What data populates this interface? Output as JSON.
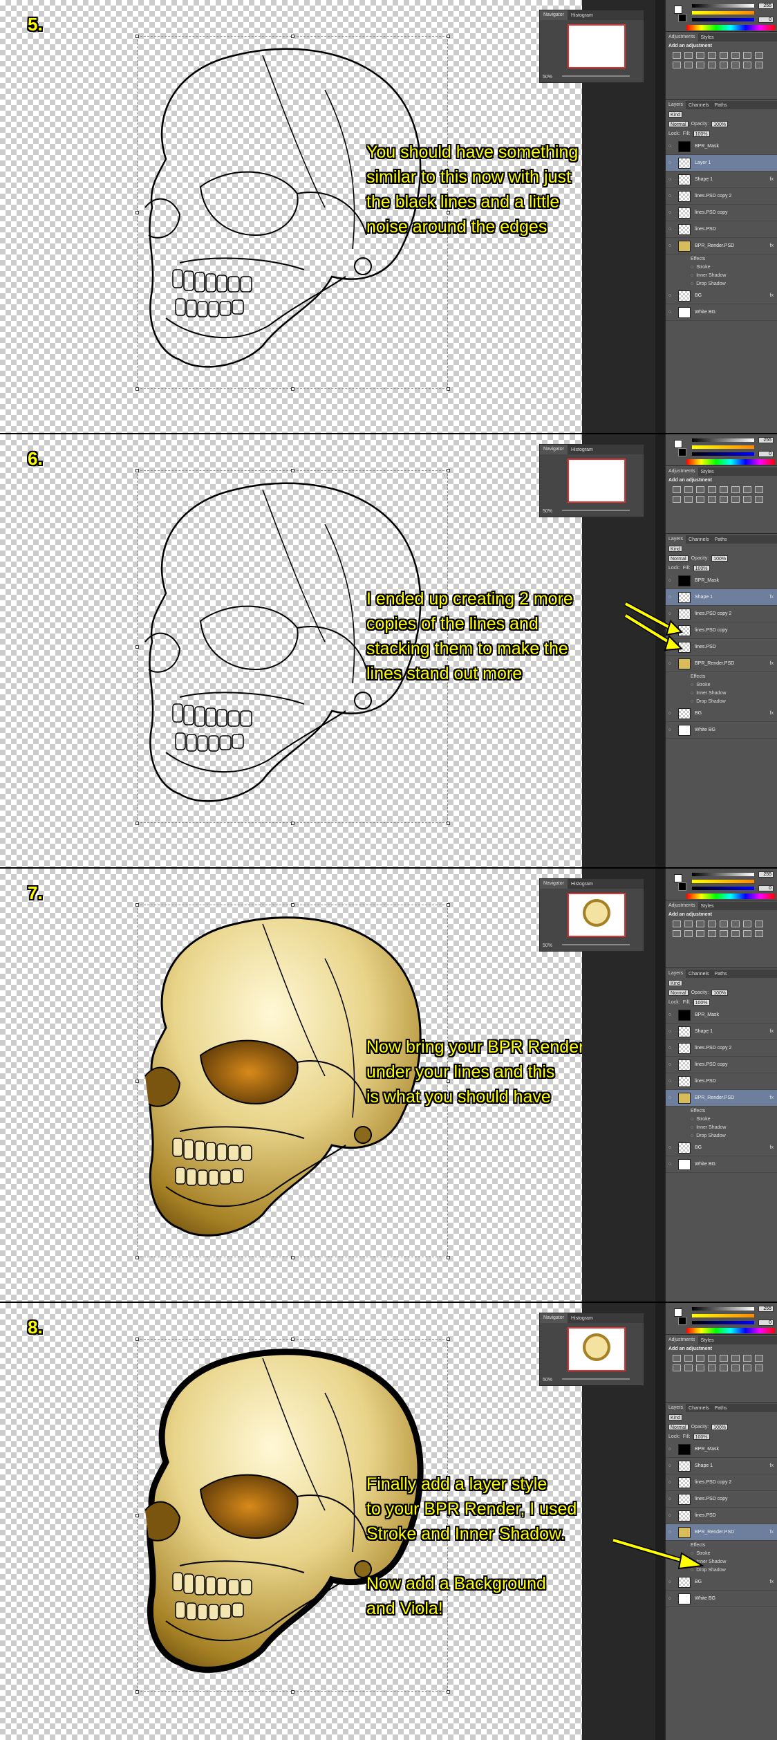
{
  "steps": [
    {
      "number": "5.",
      "caption": "You should have something\nsimilar to this now with just\nthe black lines and a little\nnoise around the edges",
      "render": "lines",
      "selected_layer": "Layer 1",
      "layers": [
        {
          "name": "BPR_Mask",
          "thumb": "mask"
        },
        {
          "name": "Layer 1",
          "thumb": "checker"
        },
        {
          "name": "Shape 1",
          "thumb": "checker",
          "fx": true
        },
        {
          "name": "lines.PSD copy 2",
          "thumb": "checker"
        },
        {
          "name": "lines.PSD copy",
          "thumb": "checker"
        },
        {
          "name": "lines.PSD",
          "thumb": "checker"
        },
        {
          "name": "BPR_Render.PSD",
          "thumb": "skull",
          "fx": true,
          "effects": [
            "Effects",
            "Stroke",
            "Inner Shadow",
            "Drop Shadow"
          ]
        },
        {
          "name": "BG",
          "thumb": "checker",
          "fx": true
        },
        {
          "name": "White BG",
          "thumb": "white"
        }
      ]
    },
    {
      "number": "6.",
      "caption": "I ended up creating 2 more\ncopies of the lines and\nstacking them to make the\nlines stand out more",
      "render": "lines",
      "selected_layer": "Shape 1",
      "layers": [
        {
          "name": "BPR_Mask",
          "thumb": "mask"
        },
        {
          "name": "Shape 1",
          "thumb": "checker",
          "fx": true
        },
        {
          "name": "lines.PSD copy 2",
          "thumb": "checker"
        },
        {
          "name": "lines.PSD copy",
          "thumb": "checker"
        },
        {
          "name": "lines.PSD",
          "thumb": "checker"
        },
        {
          "name": "BPR_Render.PSD",
          "thumb": "skull",
          "fx": true,
          "effects": [
            "Effects",
            "Stroke",
            "Inner Shadow",
            "Drop Shadow"
          ]
        },
        {
          "name": "BG",
          "thumb": "checker",
          "fx": true
        },
        {
          "name": "White BG",
          "thumb": "white"
        }
      ]
    },
    {
      "number": "7.",
      "caption": "Now bring your BPR Render\nunder your lines and this\nis what you should have",
      "render": "color",
      "selected_layer": "BPR_Render.PSD",
      "layers": [
        {
          "name": "BPR_Mask",
          "thumb": "mask"
        },
        {
          "name": "Shape 1",
          "thumb": "checker",
          "fx": true
        },
        {
          "name": "lines.PSD copy 2",
          "thumb": "checker"
        },
        {
          "name": "lines.PSD copy",
          "thumb": "checker"
        },
        {
          "name": "lines.PSD",
          "thumb": "checker"
        },
        {
          "name": "BPR_Render.PSD",
          "thumb": "skull",
          "fx": true,
          "effects": [
            "Effects",
            "Stroke",
            "Inner Shadow",
            "Drop Shadow"
          ]
        },
        {
          "name": "BG",
          "thumb": "checker",
          "fx": true
        },
        {
          "name": "White BG",
          "thumb": "white"
        }
      ]
    },
    {
      "number": "8.",
      "caption": "Finally add a layer style\nto your BPR Render, I used\nStroke and Inner Shadow.\n\nNow add a Background\nand Viola!",
      "render": "color-stroke",
      "selected_layer": "BPR_Render.PSD",
      "layers": [
        {
          "name": "BPR_Mask",
          "thumb": "mask"
        },
        {
          "name": "Shape 1",
          "thumb": "checker",
          "fx": true
        },
        {
          "name": "lines.PSD copy 2",
          "thumb": "checker"
        },
        {
          "name": "lines.PSD copy",
          "thumb": "checker"
        },
        {
          "name": "lines.PSD",
          "thumb": "checker"
        },
        {
          "name": "BPR_Render.PSD",
          "thumb": "skull",
          "fx": true,
          "effects": [
            "Effects",
            "Stroke",
            "Inner Shadow",
            "Drop Shadow"
          ]
        },
        {
          "name": "BG",
          "thumb": "checker",
          "fx": true
        },
        {
          "name": "White BG",
          "thumb": "white"
        }
      ]
    }
  ],
  "ui": {
    "navigator_tab": "Navigator",
    "histogram_tab": "Histogram",
    "zoom": "50%",
    "color_value_1": "255",
    "color_value_2": "0",
    "adjustments_tab": "Adjustments",
    "styles_tab": "Styles",
    "add_adjustment": "Add an adjustment",
    "layers_tab": "Layers",
    "channels_tab": "Channels",
    "paths_tab": "Paths",
    "kind_label": "Kind",
    "blend_mode": "Normal",
    "opacity_label": "Opacity:",
    "opacity_value": "100%",
    "lock_label": "Lock:",
    "fill_label": "Fill:",
    "fill_value": "100%",
    "fx_label": "fx"
  },
  "colors": {
    "caption_text": "#ffff00",
    "skull_base": "#e8d48a",
    "skull_shadow": "#8a6a1a",
    "selected_layer": "#6d7f9d"
  }
}
